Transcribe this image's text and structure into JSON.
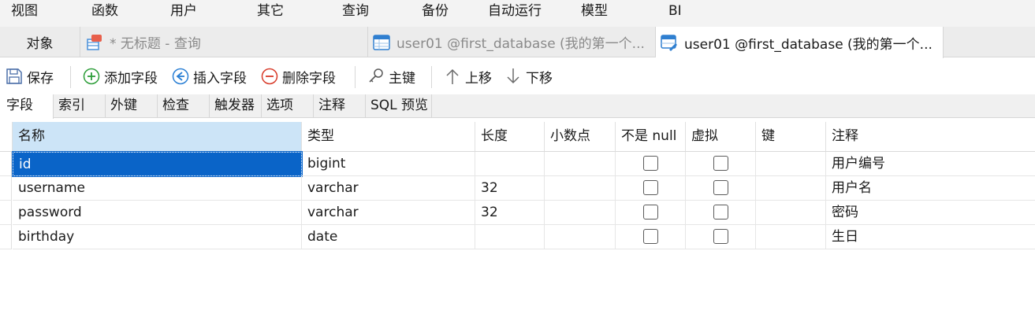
{
  "menu": [
    "视图",
    "函数",
    "用户",
    "其它",
    "查询",
    "备份",
    "自动运行",
    "模型",
    "BI"
  ],
  "tabs": [
    {
      "label": "对象",
      "icon": "none"
    },
    {
      "label": "* 无标题 - 查询",
      "icon": "query-icon"
    },
    {
      "label": "user01 @first_database (我的第一个...",
      "icon": "table-icon"
    },
    {
      "label": "user01 @first_database (我的第一个...",
      "icon": "table-design-icon"
    }
  ],
  "toolbar": {
    "save": "保存",
    "add_field": "添加字段",
    "insert_field": "插入字段",
    "delete_field": "删除字段",
    "primary_key": "主键",
    "move_up": "上移",
    "move_down": "下移"
  },
  "subtabs": [
    "字段",
    "索引",
    "外键",
    "检查",
    "触发器",
    "选项",
    "注释",
    "SQL 预览"
  ],
  "columns": [
    "名称",
    "类型",
    "长度",
    "小数点",
    "不是 null",
    "虚拟",
    "键",
    "注释"
  ],
  "rows": [
    {
      "name": "id",
      "type": "bigint",
      "length": "",
      "decimals": "",
      "not_null": false,
      "virtual": false,
      "key": "",
      "comment": "用户编号"
    },
    {
      "name": "username",
      "type": "varchar",
      "length": "32",
      "decimals": "",
      "not_null": false,
      "virtual": false,
      "key": "",
      "comment": "用户名"
    },
    {
      "name": "password",
      "type": "varchar",
      "length": "32",
      "decimals": "",
      "not_null": false,
      "virtual": false,
      "key": "",
      "comment": "密码"
    },
    {
      "name": "birthday",
      "type": "date",
      "length": "",
      "decimals": "",
      "not_null": false,
      "virtual": false,
      "key": "",
      "comment": "生日"
    }
  ],
  "colors": {
    "selection": "#0a64c8",
    "header_selected": "#cce4f7",
    "add": "#2e9e3a",
    "insert": "#2a7fd4",
    "delete": "#d83b2a"
  }
}
